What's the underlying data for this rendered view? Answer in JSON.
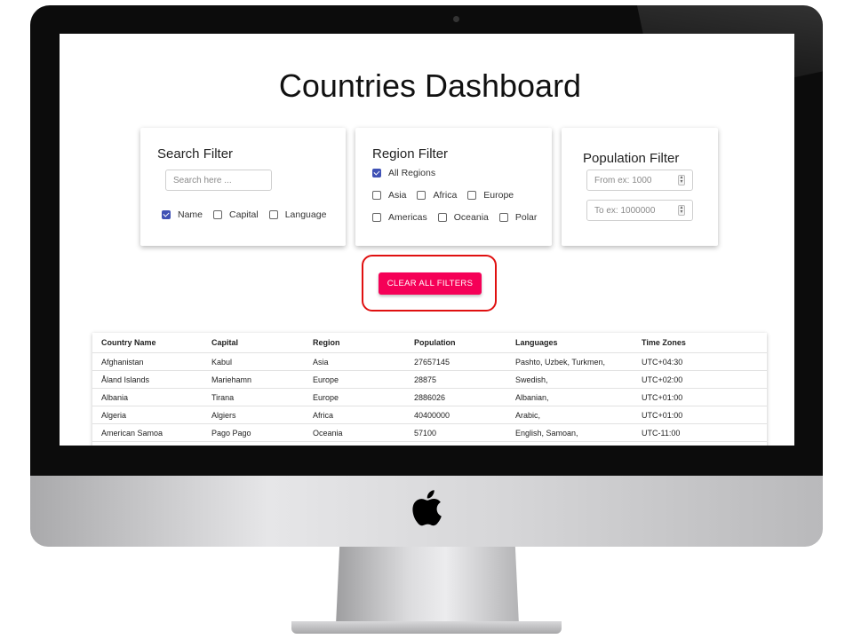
{
  "page": {
    "title": "Countries Dashboard"
  },
  "search_filter": {
    "title": "Search Filter",
    "input_placeholder": "Search here ...",
    "options": [
      {
        "label": "Name",
        "checked": true
      },
      {
        "label": "Capital",
        "checked": false
      },
      {
        "label": "Language",
        "checked": false
      }
    ]
  },
  "region_filter": {
    "title": "Region Filter",
    "all_regions": {
      "label": "All Regions",
      "checked": true
    },
    "regions": [
      {
        "label": "Asia",
        "checked": false
      },
      {
        "label": "Africa",
        "checked": false
      },
      {
        "label": "Europe",
        "checked": false
      },
      {
        "label": "Americas",
        "checked": false
      },
      {
        "label": "Oceania",
        "checked": false
      },
      {
        "label": "Polar",
        "checked": false
      }
    ]
  },
  "population_filter": {
    "title": "Population Filter",
    "from_placeholder": "From ex: 1000",
    "to_placeholder": "To ex: 1000000"
  },
  "actions": {
    "clear_all_label": "CLEAR ALL FILTERS",
    "highlight_color": "#e01010",
    "button_color": "#f50057"
  },
  "table": {
    "columns": [
      "Country Name",
      "Capital",
      "Region",
      "Population",
      "Languages",
      "Time Zones"
    ],
    "rows": [
      [
        "Afghanistan",
        "Kabul",
        "Asia",
        "27657145",
        "Pashto, Uzbek, Turkmen,",
        "UTC+04:30"
      ],
      [
        "Åland Islands",
        "Mariehamn",
        "Europe",
        "28875",
        "Swedish,",
        "UTC+02:00"
      ],
      [
        "Albania",
        "Tirana",
        "Europe",
        "2886026",
        "Albanian,",
        "UTC+01:00"
      ],
      [
        "Algeria",
        "Algiers",
        "Africa",
        "40400000",
        "Arabic,",
        "UTC+01:00"
      ],
      [
        "American Samoa",
        "Pago Pago",
        "Oceania",
        "57100",
        "English, Samoan,",
        "UTC-11:00"
      ]
    ]
  },
  "icons": {
    "checkbox_checked_color": "#3f51b5",
    "device_logo": "apple-logo-icon"
  }
}
